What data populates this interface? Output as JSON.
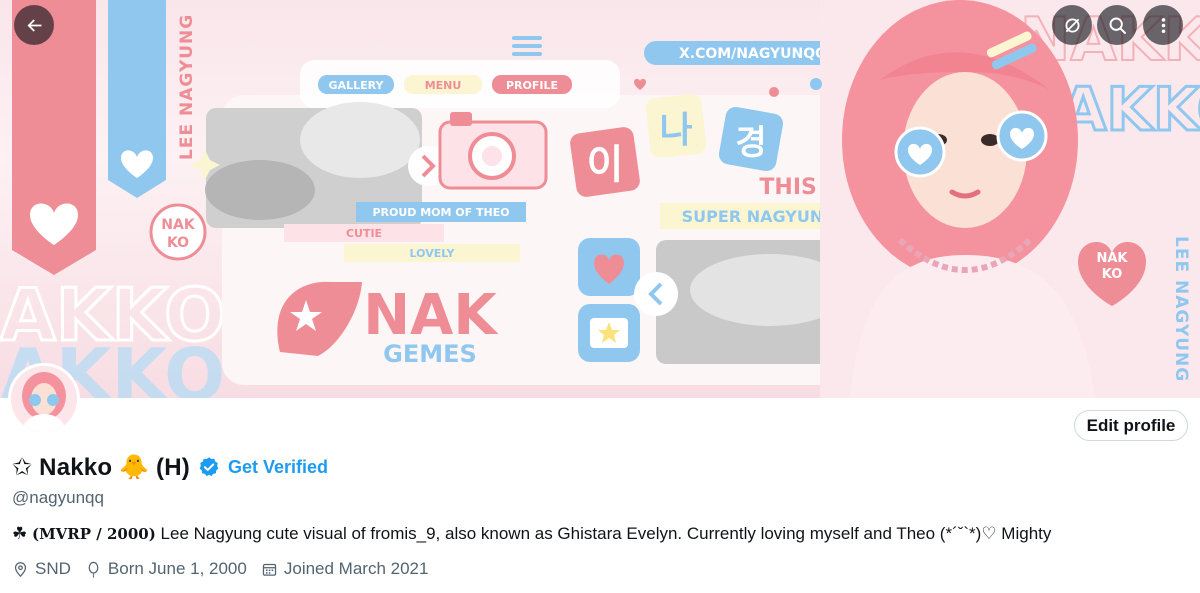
{
  "banner": {
    "nav_labels": [
      "GALLERY",
      "MENU",
      "PROFILE"
    ],
    "url_text": "X.COM/NAGYUNQQ",
    "side_text_left": "LEE NAGYUNG",
    "side_text_right": "LEE NAGYUNG",
    "nak_ko": "NAK\nKO",
    "tag_proud": "PROUD MOM OF THEO",
    "tag_cutie": "CUTIE",
    "tag_lovely": "LOVELY",
    "hangul_1": "이",
    "hangul_2": "나",
    "hangul_3": "경",
    "this_is": "THIS IS",
    "super": "SUPER NAGYUNG",
    "logo_nak": "NAK",
    "logo_games": "GEMES",
    "akko_left": "AKKO",
    "akko_right": "AKKO",
    "colors": {
      "pink": "#ef8d96",
      "blue": "#8fc7ef",
      "light_blue": "#cfe6f6",
      "cream": "#fbf5d2"
    }
  },
  "toolbar": {
    "back_icon": "arrow-left-icon",
    "grok_icon": "grok-icon",
    "search_icon": "search-icon",
    "more_icon": "more-vertical-icon"
  },
  "profile": {
    "display_name": "✩ Nakko 🐥 (H)",
    "get_verified": "Get Verified",
    "handle": "@nagyunqq",
    "edit_profile": "Edit profile",
    "bio_prefix": "☘ ",
    "bio_serif": "(MVRP / 2000)",
    "bio_rest": " Lee Nagyung cute visual of fromis_9, also known as Ghistara Evelyn. Currently loving myself and Theo (*´ˇ`*)♡ Mighty",
    "location": "SND",
    "birthday": "Born June 1, 2000",
    "joined": "Joined March 2021",
    "verified_color": "#1d9bf0"
  }
}
